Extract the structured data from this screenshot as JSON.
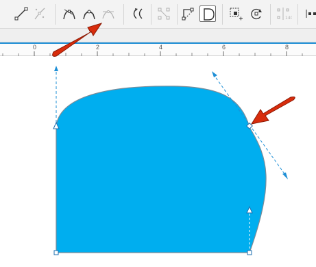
{
  "toolbar": {
    "tools": [
      {
        "name": "line-to-curve-icon",
        "enabled": true
      },
      {
        "name": "break-curve-icon",
        "enabled": false
      },
      {
        "name": "smooth-node-icon",
        "enabled": true
      },
      {
        "name": "cusp-node-icon",
        "enabled": true
      },
      {
        "name": "symmetrical-node-icon",
        "enabled": false
      },
      {
        "name": "reverse-direction-icon",
        "enabled": true
      },
      {
        "name": "extract-subpath-icon",
        "enabled": false
      },
      {
        "name": "close-curve-icon",
        "enabled": true,
        "selected": true
      },
      {
        "name": "select-all-nodes-icon",
        "enabled": true
      },
      {
        "name": "rotate-nodes-icon",
        "enabled": true
      },
      {
        "name": "align-nodes-icon",
        "enabled": false
      },
      {
        "name": "more-tools-icon",
        "enabled": true
      }
    ]
  },
  "ruler": {
    "labels": [
      "0",
      "2",
      "4",
      "6",
      "8"
    ]
  },
  "colors": {
    "shape_fill": "#00aeef",
    "guide_blue": "#1e8fd6",
    "arrow_red": "#d82c0c",
    "toolbar_bg": "#f3f3f3"
  }
}
